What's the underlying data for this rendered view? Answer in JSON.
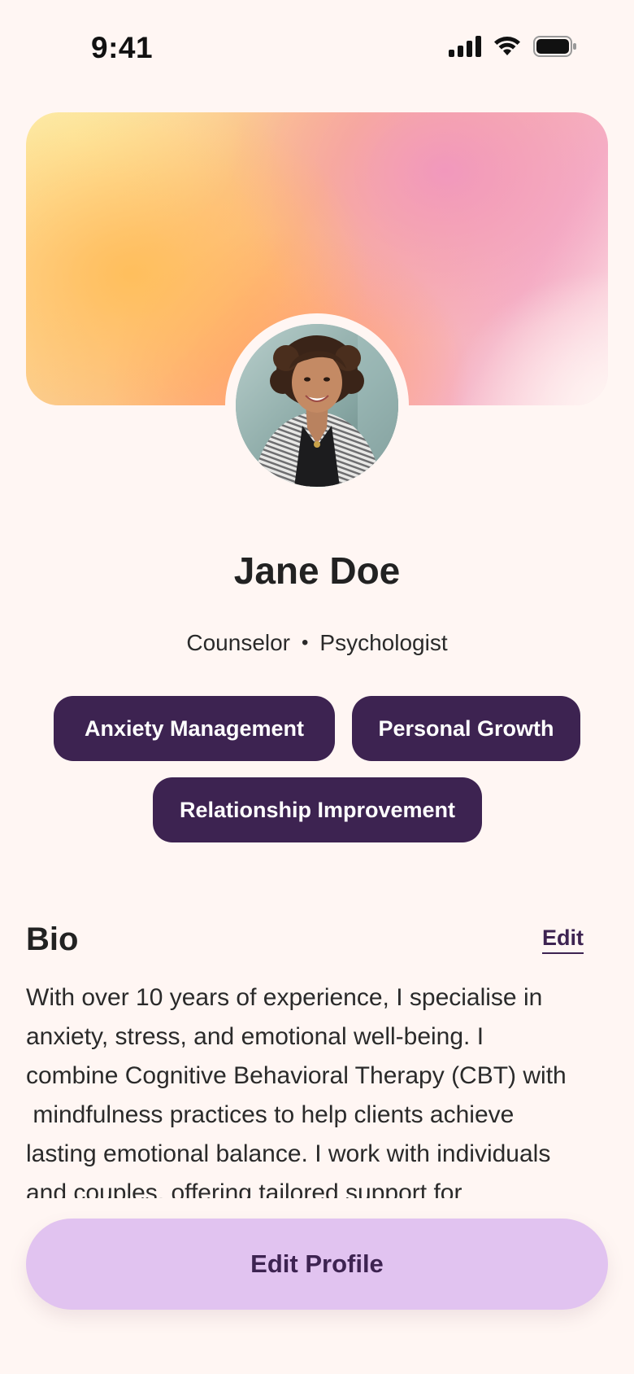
{
  "status_bar": {
    "time": "9:41",
    "icons": [
      "cellular-signal-icon",
      "wifi-icon",
      "battery-icon"
    ]
  },
  "profile": {
    "name": "Jane Doe",
    "role_primary": "Counselor",
    "role_separator": "•",
    "role_secondary": "Psychologist",
    "avatar": "profile-photo"
  },
  "tags": [
    {
      "label": "Anxiety Management"
    },
    {
      "label": "Personal Growth"
    },
    {
      "label": "Relationship Improvement"
    }
  ],
  "bio": {
    "title": "Bio",
    "edit_label": "Edit",
    "lines": [
      "With over 10 years of experience, I specialise in",
      "anxiety, stress, and emotional well-being. I",
      "combine Cognitive Behavioral Therapy (CBT) with",
      " mindfulness practices to help clients achieve",
      "lasting emotional balance. I work with individuals",
      "and couples, offering tailored support for"
    ]
  },
  "actions": {
    "edit_profile_label": "Edit Profile"
  },
  "colors": {
    "background": "#FFF6F3",
    "tag_background": "#3D2351",
    "tag_text": "#FFFFFF",
    "button_background": "#E1C3F0",
    "button_text": "#3D2351"
  }
}
